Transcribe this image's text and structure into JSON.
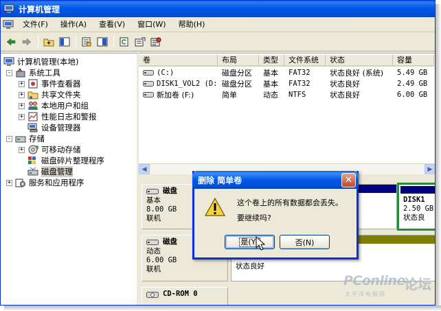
{
  "window": {
    "title": "计算机管理",
    "colors": {
      "titlebar": "#0058e6",
      "selection": "#d4d0c8",
      "volume_stripe": "#000080",
      "volume_stripe_dynamic": "#808000"
    }
  },
  "menu": [
    {
      "label": "文件(F)"
    },
    {
      "label": "操作(A)"
    },
    {
      "label": "查看(V)"
    },
    {
      "label": "窗口(W)"
    },
    {
      "label": "帮助(H)"
    }
  ],
  "toolbar": {
    "icons": [
      "back-arrow-icon",
      "forward-arrow-icon",
      "up-folder-icon",
      "show-hide-tree-icon",
      "properties-icon",
      "help-icon",
      "refresh-icon",
      "export-list-icon",
      "settings-icon"
    ]
  },
  "tree": {
    "root": "计算机管理(本地)",
    "items": [
      {
        "label": "系统工具",
        "level": 1,
        "expander": "-"
      },
      {
        "label": "事件查看器",
        "level": 2,
        "expander": "+"
      },
      {
        "label": "共享文件夹",
        "level": 2,
        "expander": "+"
      },
      {
        "label": "本地用户和组",
        "level": 2,
        "expander": "+"
      },
      {
        "label": "性能日志和警报",
        "level": 2,
        "expander": "+"
      },
      {
        "label": "设备管理器",
        "level": 2,
        "expander": ""
      },
      {
        "label": "存储",
        "level": 1,
        "expander": "-"
      },
      {
        "label": "可移动存储",
        "level": 2,
        "expander": "+"
      },
      {
        "label": "磁盘碎片整理程序",
        "level": 2,
        "expander": ""
      },
      {
        "label": "磁盘管理",
        "level": 2,
        "expander": "",
        "selected": true
      },
      {
        "label": "服务和应用程序",
        "level": 1,
        "expander": "+"
      }
    ]
  },
  "volumes": {
    "columns": [
      "卷",
      "布局",
      "类型",
      "文件系统",
      "状态",
      "容量"
    ],
    "rows": [
      {
        "volume": "(C:)",
        "layout": "磁盘分区",
        "type": "基本",
        "fs": "FAT32",
        "status": "状态良好 (系统)",
        "capacity": "5.49 GB"
      },
      {
        "volume": "DISK1_VOL2 (D:)",
        "layout": "磁盘分区",
        "type": "基本",
        "fs": "FAT32",
        "status": "状态良好",
        "capacity": "2.49 GB"
      },
      {
        "volume": "新加卷 (F:)",
        "layout": "简单",
        "type": "动态",
        "fs": "NTFS",
        "status": "状态良好",
        "capacity": "6.00 GB"
      }
    ]
  },
  "disks": [
    {
      "title": "磁盘",
      "type": "基本",
      "size": "8.00 GB",
      "state": "联机"
    },
    {
      "title": "磁盘",
      "type": "动态",
      "size": "6.00 GB",
      "state": "联机"
    },
    {
      "title": "CD-ROM 0"
    }
  ],
  "disk_volumes": {
    "d_drive": {
      "name": "DISK1",
      "size": "2.50 GB",
      "status": "状态良"
    },
    "f_drive": {
      "line1": "6.00 GB NTFS",
      "line2": "状态良好"
    }
  },
  "dialog": {
    "title": "删除 简单卷",
    "message_line1": "这个卷上的所有数据都会丢失。",
    "message_line2": "要继续吗?",
    "yes_label": "是(Y)",
    "no_label": "否(N)"
  },
  "watermark": {
    "brand": "PConline",
    "forum": "论坛",
    "sub": "太平洋电脑网"
  }
}
